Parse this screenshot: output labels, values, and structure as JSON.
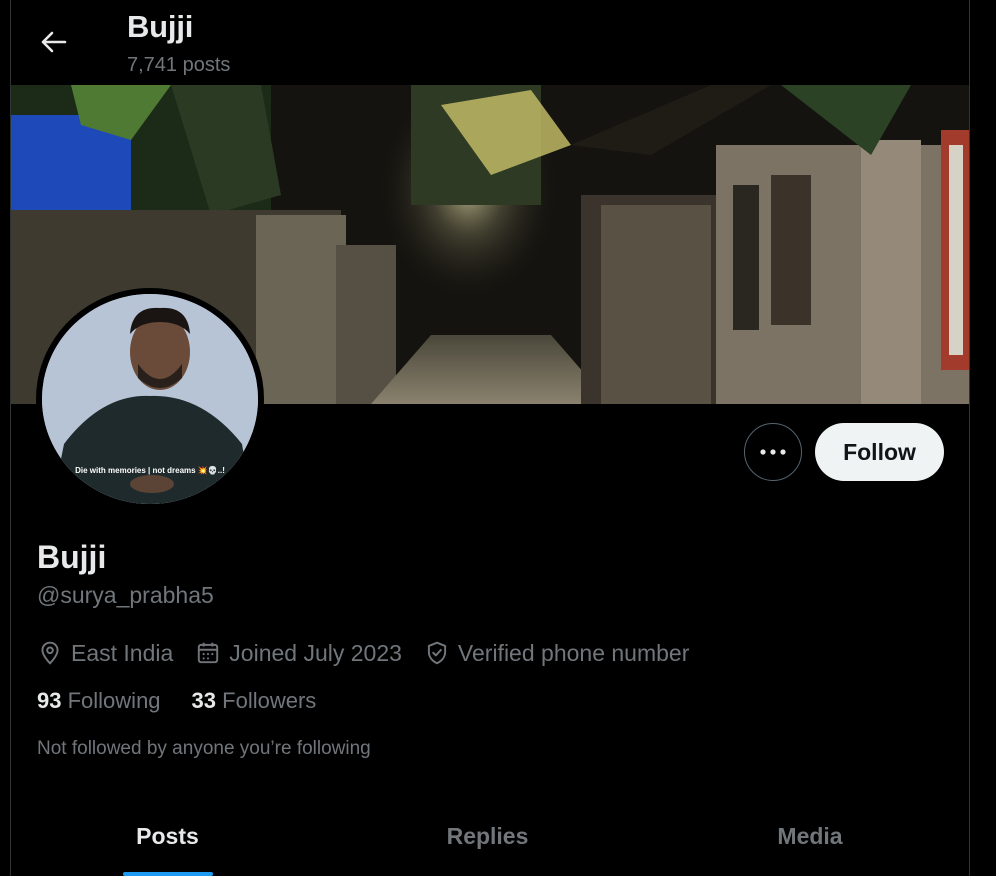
{
  "header": {
    "title": "Bujji",
    "posts_count": "7,741 posts",
    "back_icon": "arrow-left-icon"
  },
  "avatar": {
    "caption": "Die with memories | not dreams 💥💀..!"
  },
  "actions": {
    "more_icon": "more-horizontal-icon",
    "follow_label": "Follow"
  },
  "profile": {
    "name": "Bujji",
    "handle": "@surya_prabha5",
    "location": "East India",
    "joined": "Joined July 2023",
    "verified": "Verified phone number",
    "following_count": "93",
    "following_label": "Following",
    "followers_count": "33",
    "followers_label": "Followers",
    "followed_note": "Not followed by anyone you’re following"
  },
  "tabs": [
    {
      "label": "Posts",
      "active": true
    },
    {
      "label": "Replies",
      "active": false
    },
    {
      "label": "Media",
      "active": false
    }
  ],
  "colors": {
    "background": "#000000",
    "text_primary": "#e7e9ea",
    "text_secondary": "#71767b",
    "accent": "#1d9bf0",
    "follow_button_bg": "#eff3f4"
  }
}
